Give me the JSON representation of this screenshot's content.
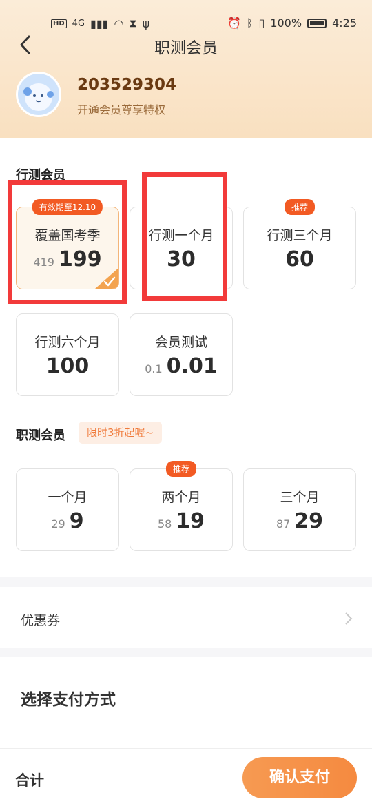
{
  "status_bar": {
    "hd": "HD",
    "network": "4G",
    "battery": "100%",
    "time": "4:25"
  },
  "header": {
    "title": "职测会员"
  },
  "user": {
    "id": "203529304",
    "subtitle": "开通会员尊享特权"
  },
  "xingce": {
    "title": "行测会员",
    "cards": [
      {
        "name": "覆盖国考季",
        "old_price": "419",
        "price": "199",
        "badge": "有效期至12.10",
        "selected": true
      },
      {
        "name": "行测一个月",
        "old_price": "",
        "price": "30",
        "badge": "",
        "selected": false
      },
      {
        "name": "行测三个月",
        "old_price": "",
        "price": "60",
        "badge": "推荐",
        "selected": false
      },
      {
        "name": "行测六个月",
        "old_price": "",
        "price": "100",
        "badge": "",
        "selected": false
      },
      {
        "name": "会员测试",
        "old_price": "0.1",
        "price": "0.01",
        "badge": "",
        "selected": false
      }
    ]
  },
  "zhice": {
    "title": "职测会员",
    "promo": "限时3折起喔~",
    "cards": [
      {
        "name": "一个月",
        "old_price": "29",
        "price": "9",
        "badge": ""
      },
      {
        "name": "两个月",
        "old_price": "58",
        "price": "19",
        "badge": "推荐"
      },
      {
        "name": "三个月",
        "old_price": "87",
        "price": "29",
        "badge": ""
      }
    ]
  },
  "coupon": {
    "label": "优惠券"
  },
  "payment": {
    "title": "选择支付方式"
  },
  "footer": {
    "total_label": "合计",
    "confirm_label": "确认支付"
  },
  "colors": {
    "accent": "#f25a23",
    "highlight": "#f23a3a",
    "button": "#f58a40"
  }
}
